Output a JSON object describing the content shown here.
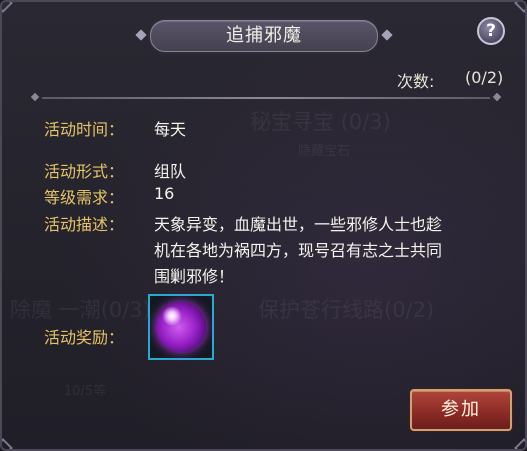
{
  "dialog": {
    "title": "追捕邪魔",
    "help_symbol": "?",
    "count_label": "次数:",
    "count_value": "(0/2)"
  },
  "fields": [
    {
      "label": "活动时间：",
      "value": "每天"
    },
    {
      "label": "活动形式：",
      "value": "组队"
    },
    {
      "label": "等级需求：",
      "value": "16"
    },
    {
      "label": "活动描述："
    },
    {
      "label": "活动奖励："
    }
  ],
  "description_lines": [
    "天象异变，血魔出世，一些邪修人士也趁",
    "机在各地为祸四方，现号召有志之士共同",
    "围剿邪修！"
  ],
  "reward": {
    "icon": "purple-orb-icon"
  },
  "join_button": "参加",
  "colors": {
    "label": "#e6c36a",
    "value": "#f5f3ec",
    "button_red": "#8a2a25",
    "slot_border": "#2aa9d0"
  }
}
